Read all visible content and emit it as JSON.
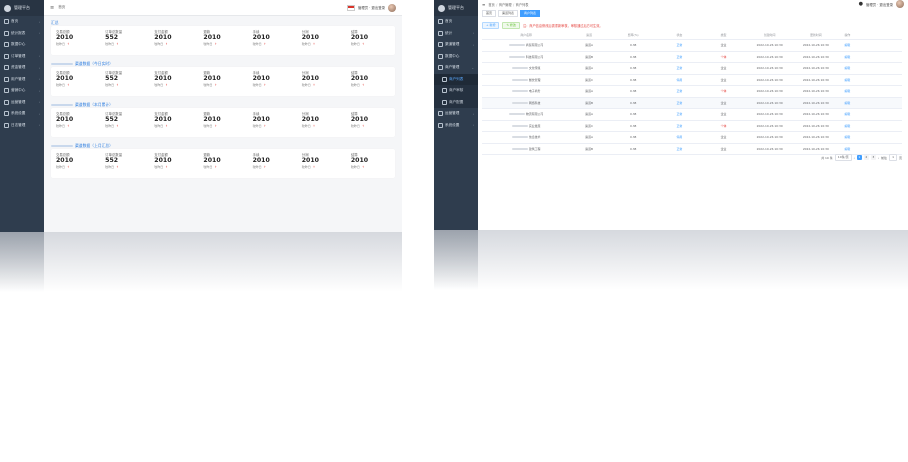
{
  "left": {
    "sidebar": {
      "logo_text": "管理平台",
      "items": [
        {
          "label": "首页",
          "arrow": "›"
        },
        {
          "label": "统计报表",
          "arrow": "›"
        },
        {
          "label": "数据中心",
          "arrow": ""
        },
        {
          "label": "订单管理",
          "arrow": "›"
        },
        {
          "label": "资金管理",
          "arrow": "›"
        },
        {
          "label": "用户管理",
          "arrow": "›"
        },
        {
          "label": "营销中心",
          "arrow": "›"
        },
        {
          "label": "运营管理",
          "arrow": "›"
        },
        {
          "label": "系统设置",
          "arrow": "›"
        },
        {
          "label": "日志管理",
          "arrow": "›"
        }
      ]
    },
    "topbar": {
      "breadcrumb": "首页",
      "user_text": "管理员 · 退出登录"
    },
    "sections": [
      {
        "title": "汇总",
        "stats": [
          {
            "label": "交易总额",
            "value": "2010",
            "foot": "较昨日",
            "trend": "↑"
          },
          {
            "label": "订单总数量",
            "value": "552",
            "foot": "较昨日",
            "trend": "↑"
          },
          {
            "label": "支付金额",
            "value": "2010",
            "foot": "较昨日",
            "trend": "↑"
          },
          {
            "label": "退款",
            "value": "2010",
            "foot": "较昨日",
            "trend": "↑"
          },
          {
            "label": "手续",
            "value": "2010",
            "foot": "较昨日",
            "trend": "↑"
          },
          {
            "label": "分润",
            "value": "2010",
            "foot": "较昨日",
            "trend": "↑"
          },
          {
            "label": "结算",
            "value": "2010",
            "foot": "较昨日",
            "trend": "↑"
          }
        ]
      },
      {
        "title": "渠道数据（今日实时）",
        "stats": [
          {
            "label": "交易总额",
            "value": "2010",
            "foot": "较昨日",
            "trend": "↑"
          },
          {
            "label": "订单总数量",
            "value": "552",
            "foot": "较昨日",
            "trend": "↑"
          },
          {
            "label": "支付金额",
            "value": "2010",
            "foot": "较昨日",
            "trend": "↑"
          },
          {
            "label": "退款",
            "value": "2010",
            "foot": "较昨日",
            "trend": "↑"
          },
          {
            "label": "手续",
            "value": "2010",
            "foot": "较昨日",
            "trend": "↑"
          },
          {
            "label": "分润",
            "value": "2010",
            "foot": "较昨日",
            "trend": "↑"
          },
          {
            "label": "结算",
            "value": "2010",
            "foot": "较昨日",
            "trend": "↑"
          }
        ]
      },
      {
        "title": "渠道数据（本月累计）",
        "stats": [
          {
            "label": "交易总额",
            "value": "2010",
            "foot": "较昨日",
            "trend": "↑"
          },
          {
            "label": "订单总数量",
            "value": "552",
            "foot": "较昨日",
            "trend": "↑"
          },
          {
            "label": "支付金额",
            "value": "2010",
            "foot": "较昨日",
            "trend": "↑"
          },
          {
            "label": "退款",
            "value": "2010",
            "foot": "较昨日",
            "trend": "↑"
          },
          {
            "label": "手续",
            "value": "2010",
            "foot": "较昨日",
            "trend": "↑"
          },
          {
            "label": "分润",
            "value": "2010",
            "foot": "较昨日",
            "trend": "↑"
          },
          {
            "label": "结算",
            "value": "2010",
            "foot": "较昨日",
            "trend": "↑"
          }
        ]
      },
      {
        "title": "渠道数据（上月汇总）",
        "stats": [
          {
            "label": "交易总额",
            "value": "2010",
            "foot": "较昨日",
            "trend": "↑"
          },
          {
            "label": "订单总数量",
            "value": "552",
            "foot": "较昨日",
            "trend": "↑"
          },
          {
            "label": "支付金额",
            "value": "2010",
            "foot": "较昨日",
            "trend": "↑"
          },
          {
            "label": "退款",
            "value": "2010",
            "foot": "较昨日",
            "trend": "↑"
          },
          {
            "label": "手续",
            "value": "2010",
            "foot": "较昨日",
            "trend": "↑"
          },
          {
            "label": "分润",
            "value": "2010",
            "foot": "较昨日",
            "trend": "↑"
          },
          {
            "label": "结算",
            "value": "2010",
            "foot": "较昨日",
            "trend": "↑"
          }
        ]
      }
    ]
  },
  "right": {
    "sidebar": {
      "logo_text": "管理平台",
      "items": [
        {
          "label": "首页",
          "arrow": "",
          "sub": false,
          "active": false
        },
        {
          "label": "统计",
          "arrow": "›",
          "sub": false,
          "active": false
        },
        {
          "label": "渠道管理",
          "arrow": "›",
          "sub": false,
          "active": false
        },
        {
          "label": "数据中心",
          "arrow": "",
          "sub": false,
          "active": false
        },
        {
          "label": "商户管理",
          "arrow": "⌄",
          "sub": false,
          "active": false
        },
        {
          "label": "商户列表",
          "arrow": "",
          "sub": true,
          "active": true
        },
        {
          "label": "商户审核",
          "arrow": "",
          "sub": true,
          "active": false
        },
        {
          "label": "商户配置",
          "arrow": "",
          "sub": true,
          "active": false
        },
        {
          "label": "运营管理",
          "arrow": "›",
          "sub": false,
          "active": false
        },
        {
          "label": "系统设置",
          "arrow": "›",
          "sub": false,
          "active": false
        }
      ]
    },
    "topbar": {
      "breadcrumb": [
        "首页",
        "商户管理",
        "商户列表"
      ],
      "user_text": "管理员 · 退出登录"
    },
    "tabs": [
      {
        "label": "首页",
        "active": false
      },
      {
        "label": "渠道列表",
        "active": false
      },
      {
        "label": "商户列表",
        "active": true
      }
    ],
    "toolbar": {
      "add_label": "+ 新增",
      "edit_label": "✎ 修改",
      "notice": "注：商户信息修改后需重新审核，审核通过后方可生效。"
    },
    "table": {
      "headers": [
        "商户名称",
        "渠道",
        "费率(%)",
        "状态",
        "类型",
        "创建时间",
        "更新时间",
        "操作"
      ],
      "rows": [
        {
          "name": "商贸有限公司",
          "channel": "渠道A",
          "rate": "0.38",
          "status": "正常",
          "type": "企业",
          "created": "2022-10-26 10:30",
          "updated": "2022-10-26 10:30",
          "op": "编辑",
          "alt": false
        },
        {
          "name": "科技有限公司",
          "channel": "渠道B",
          "rate": "0.38",
          "status": "正常",
          "type": "个体",
          "created": "2022-10-26 10:30",
          "updated": "2022-10-26 10:30",
          "op": "编辑",
          "alt": false
        },
        {
          "name": "文化传媒",
          "channel": "渠道A",
          "rate": "0.38",
          "status": "正常",
          "type": "企业",
          "created": "2022-10-26 10:30",
          "updated": "2022-10-26 10:30",
          "op": "编辑",
          "alt": false
        },
        {
          "name": "餐饮管理",
          "channel": "渠道C",
          "rate": "0.38",
          "status": "停用",
          "type": "企业",
          "created": "2022-10-26 10:30",
          "updated": "2022-10-26 10:30",
          "op": "编辑",
          "alt": false
        },
        {
          "name": "电子商务",
          "channel": "渠道A",
          "rate": "0.38",
          "status": "正常",
          "type": "个体",
          "created": "2022-10-26 10:30",
          "updated": "2022-10-26 10:30",
          "op": "编辑",
          "alt": false
        },
        {
          "name": "网络科技",
          "channel": "渠道B",
          "rate": "0.38",
          "status": "正常",
          "type": "企业",
          "created": "2022-10-26 10:30",
          "updated": "2022-10-26 10:30",
          "op": "编辑",
          "alt": true
        },
        {
          "name": "物流有限公司",
          "channel": "渠道A",
          "rate": "0.38",
          "status": "正常",
          "type": "企业",
          "created": "2022-10-26 10:30",
          "updated": "2022-10-26 10:30",
          "op": "编辑",
          "alt": false
        },
        {
          "name": "实业发展",
          "channel": "渠道C",
          "rate": "0.38",
          "status": "正常",
          "type": "个体",
          "created": "2022-10-26 10:30",
          "updated": "2022-10-26 10:30",
          "op": "编辑",
          "alt": false
        },
        {
          "name": "信息技术",
          "channel": "渠道A",
          "rate": "0.38",
          "status": "停用",
          "type": "企业",
          "created": "2022-10-26 10:30",
          "updated": "2022-10-26 10:30",
          "op": "编辑",
          "alt": false
        },
        {
          "name": "建筑工程",
          "channel": "渠道B",
          "rate": "0.38",
          "status": "正常",
          "type": "企业",
          "created": "2022-10-26 10:30",
          "updated": "2022-10-26 10:30",
          "op": "编辑",
          "alt": false
        }
      ]
    },
    "pager": {
      "total": "共 10 条",
      "page_size": "10条/页",
      "prev": "‹",
      "pages": [
        "1",
        "2",
        "3"
      ],
      "active_page": "1",
      "next": "›",
      "goto": "前往",
      "page_input": "1",
      "unit": "页"
    }
  },
  "colors": {
    "sidebar": "#2f3d4e",
    "accent": "#409eff",
    "danger": "#e5443f"
  }
}
